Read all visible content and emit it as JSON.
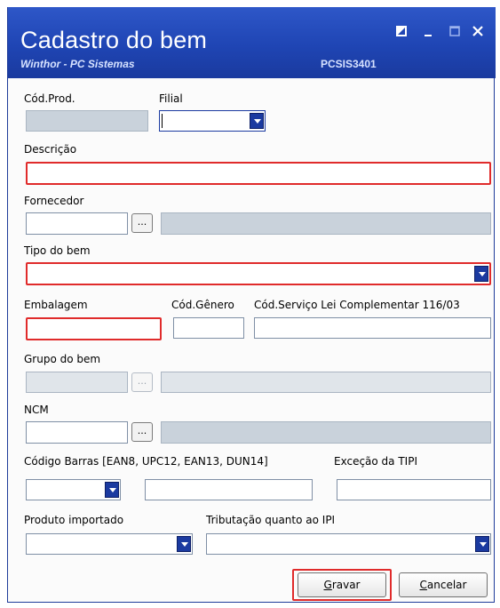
{
  "window": {
    "title": "Cadastro do bem",
    "subtitle": "Winthor - PC Sistemas",
    "code": "PCSIS3401",
    "controls": {
      "restore": "◪",
      "minimize": "‗",
      "maximize": "□",
      "close": "✕"
    }
  },
  "form": {
    "cod_prod_label": "Cód.Prod.",
    "filial_label": "Filial",
    "descricao_label": "Descrição",
    "fornecedor_label": "Fornecedor",
    "tipo_bem_label": "Tipo do bem",
    "embalagem_label": "Embalagem",
    "cod_genero_label": "Cód.Gênero",
    "cod_servico_label": "Cód.Serviço Lei Complementar 116/03",
    "grupo_bem_label": "Grupo do bem",
    "ncm_label": "NCM",
    "codigo_barras_label": "Código Barras [EAN8, UPC12, EAN13, DUN14]",
    "excecao_tipi_label": "Exceção da TIPI",
    "produto_importado_label": "Produto importado",
    "tributacao_ipi_label": "Tributação quanto ao IPI",
    "ellipsis": "..."
  },
  "buttons": {
    "gravar_first": "G",
    "gravar_rest": "ravar",
    "cancelar_first": "C",
    "cancelar_rest": "ancelar"
  },
  "colors": {
    "titlebar": "#1f45b4",
    "required_border": "#e02b2b",
    "disabled_field": "#c9d2db",
    "dropdown_arrow": "#1b3aa0"
  }
}
